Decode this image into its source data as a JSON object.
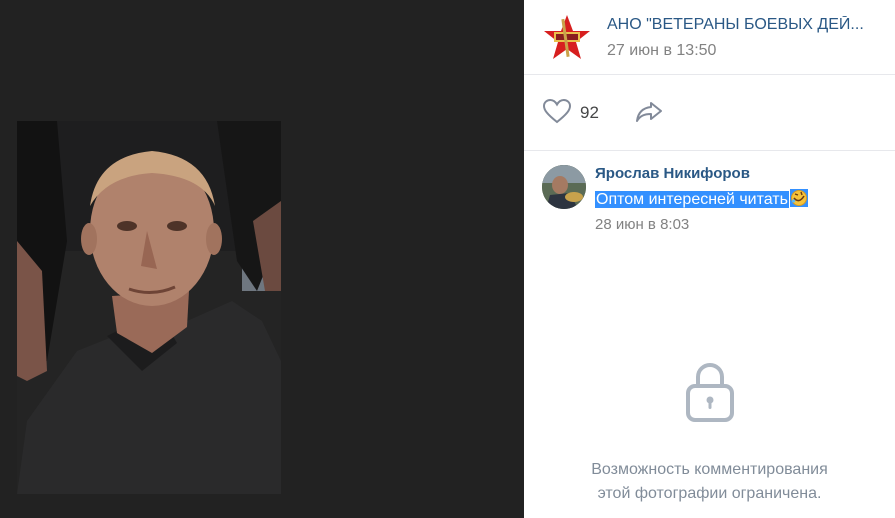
{
  "post": {
    "group_name": "АНО \"ВЕТЕРАНЫ БОЕВЫХ ДЕЙ...",
    "date": "27 июн в 13:50",
    "avatar_icon": "red-star-emblem-icon"
  },
  "actions": {
    "like_count": "92",
    "like_icon": "heart-icon",
    "share_icon": "share-arrow-icon"
  },
  "comment": {
    "author": "Ярослав Никифоров",
    "text": "Оптом интересней читать",
    "emoji": "rolling-on-floor-laughing-emoji",
    "date": "28 июн в 8:03"
  },
  "restricted": {
    "icon": "lock-icon",
    "line1": "Возможность комментирования",
    "line2": "этой фотографии ограничена."
  },
  "colors": {
    "link_blue": "#2a5885",
    "muted_gray": "#828282",
    "selection_blue": "#3390ff",
    "viewer_bg": "#222222"
  }
}
